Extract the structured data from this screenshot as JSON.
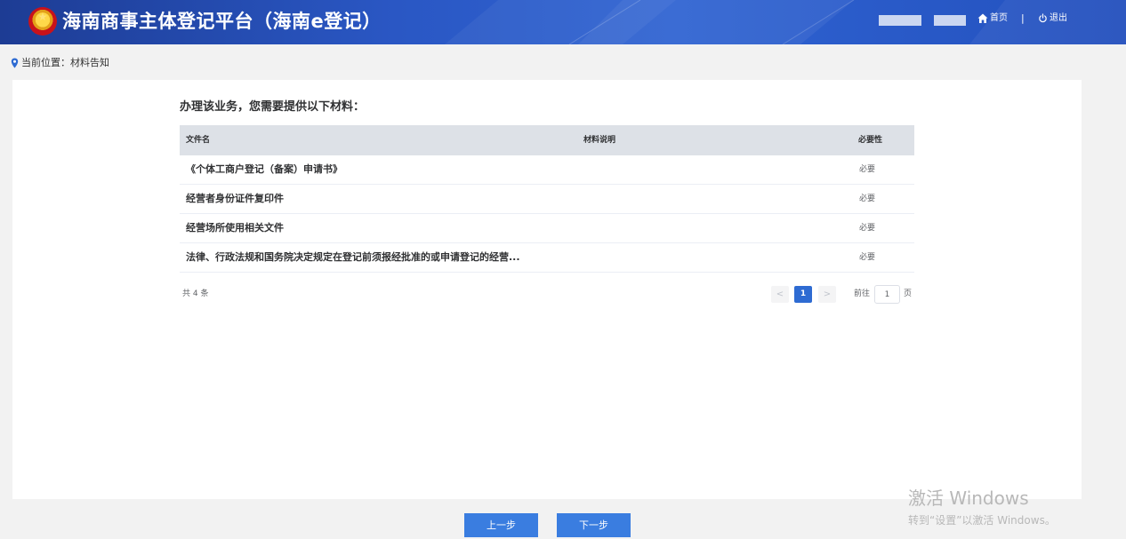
{
  "header": {
    "title": "海南商事主体登记平台（海南e登记）",
    "home_label": "首页",
    "separator": "|",
    "logout_label": "退出",
    "home_icon": "home-icon",
    "logout_icon": "power-icon",
    "emblem_icon": "national-emblem-icon"
  },
  "breadcrumb": {
    "text": "当前位置：材料告知",
    "icon": "location-pin-icon"
  },
  "main": {
    "intro": "办理该业务，您需要提供以下材料：",
    "table": {
      "columns": [
        "文件名",
        "材料说明",
        "必要性"
      ],
      "rows": [
        {
          "name": "《个体工商户登记（备案）申请书》",
          "description": "",
          "necessity": "必要"
        },
        {
          "name": "经营者身份证件复印件",
          "description": "",
          "necessity": "必要"
        },
        {
          "name": "经营场所使用相关文件",
          "description": "",
          "necessity": "必要"
        },
        {
          "name": "法律、行政法规和国务院决定规定在登记前须报经批准的或申请登记的经营...",
          "description": "",
          "necessity": "必要"
        }
      ]
    },
    "pagination": {
      "total_text": "共 4 条",
      "prev_symbol": "<",
      "next_symbol": ">",
      "current_page": "1",
      "goto_label": "前往",
      "goto_value": "1",
      "goto_unit": "页"
    }
  },
  "footer": {
    "prev_button": "上一步",
    "next_button": "下一步"
  },
  "watermark": {
    "line1": "激活 Windows",
    "line2": "转到“设置”以激活 Windows。"
  },
  "colors": {
    "header_start": "#1d3c94",
    "header_end": "#2350bd",
    "accent": "#2e6bd2",
    "button": "#3a7de0",
    "page_bg": "#f2f2f2",
    "table_header_bg": "#dde1e7"
  }
}
